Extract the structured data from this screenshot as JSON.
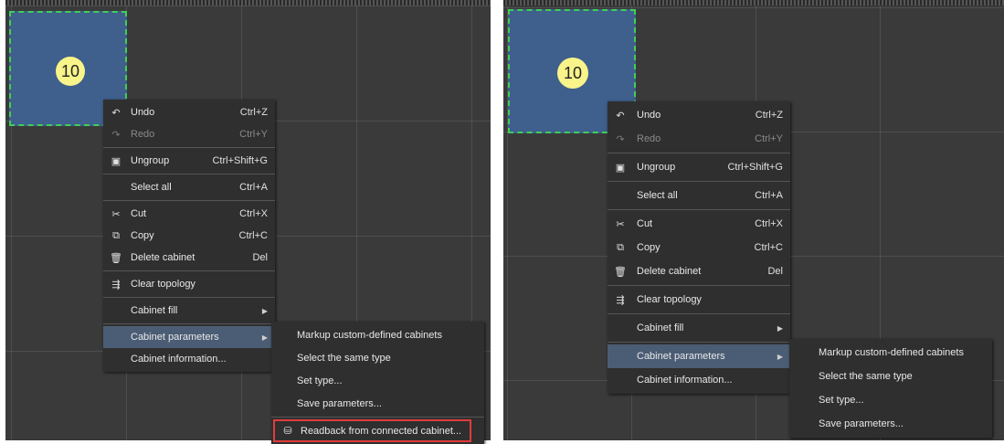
{
  "cabinet": {
    "number": "10"
  },
  "left_menu": {
    "items": [
      {
        "label": "Undo",
        "shortcut": "Ctrl+Z",
        "icon": "undo-icon",
        "disabled": false
      },
      {
        "label": "Redo",
        "shortcut": "Ctrl+Y",
        "icon": "redo-icon",
        "disabled": true
      },
      {
        "label": "Ungroup",
        "shortcut": "Ctrl+Shift+G",
        "icon": "ungroup-icon",
        "disabled": false
      },
      {
        "label": "Select all",
        "shortcut": "Ctrl+A",
        "disabled": false
      },
      {
        "label": "Cut",
        "shortcut": "Ctrl+X",
        "icon": "cut-icon",
        "disabled": false
      },
      {
        "label": "Copy",
        "shortcut": "Ctrl+C",
        "icon": "copy-icon",
        "disabled": false
      },
      {
        "label": "Delete cabinet",
        "shortcut": "Del",
        "icon": "trash-icon",
        "disabled": false
      },
      {
        "label": "Clear topology",
        "icon": "topology-icon",
        "disabled": false
      },
      {
        "label": "Cabinet fill",
        "submenu": true
      },
      {
        "label": "Cabinet parameters",
        "submenu": true,
        "highlighted": true
      },
      {
        "label": "Cabinet information..."
      }
    ]
  },
  "left_submenu": {
    "items": [
      {
        "label": "Markup custom-defined cabinets"
      },
      {
        "label": "Select the same type"
      },
      {
        "label": "Set type..."
      },
      {
        "label": "Save parameters..."
      },
      {
        "label": "Readback from connected cabinet...",
        "icon": "readback-icon",
        "outlined": true,
        "outline_color": "#e23b3b"
      }
    ]
  },
  "right_menu": {
    "items": [
      {
        "label": "Undo",
        "shortcut": "Ctrl+Z",
        "icon": "undo-icon"
      },
      {
        "label": "Redo",
        "shortcut": "Ctrl+Y",
        "icon": "redo-icon",
        "disabled": true
      },
      {
        "label": "Ungroup",
        "shortcut": "Ctrl+Shift+G",
        "icon": "ungroup-icon"
      },
      {
        "label": "Select all",
        "shortcut": "Ctrl+A"
      },
      {
        "label": "Cut",
        "shortcut": "Ctrl+X",
        "icon": "cut-icon"
      },
      {
        "label": "Copy",
        "shortcut": "Ctrl+C",
        "icon": "copy-icon"
      },
      {
        "label": "Delete cabinet",
        "shortcut": "Del",
        "icon": "trash-icon"
      },
      {
        "label": "Clear topology",
        "icon": "topology-icon"
      },
      {
        "label": "Cabinet fill",
        "submenu": true
      },
      {
        "label": "Cabinet parameters",
        "submenu": true,
        "highlighted": true
      },
      {
        "label": "Cabinet information..."
      }
    ]
  },
  "right_submenu": {
    "items": [
      {
        "label": "Markup custom-defined cabinets"
      },
      {
        "label": "Select the same type"
      },
      {
        "label": "Set type..."
      },
      {
        "label": "Save parameters..."
      }
    ]
  },
  "colors": {
    "canvas_bg": "#3a3a3a",
    "cabinet_fill": "#3f5f8c",
    "selection_dash": "#3fcf5a",
    "badge": "#f8f48a",
    "menu_bg": "#2f2f2f",
    "highlight": "#4b5d75",
    "outline_red": "#e23b3b"
  }
}
